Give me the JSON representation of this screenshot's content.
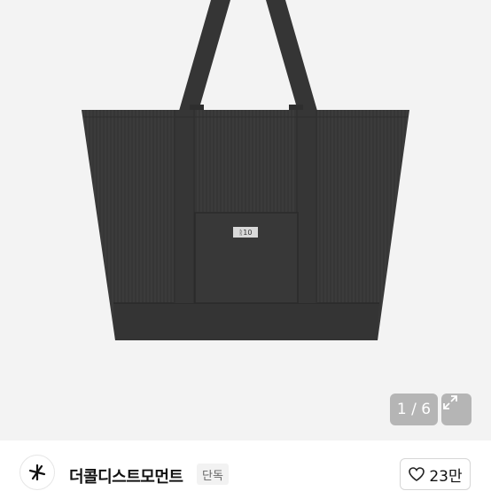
{
  "gallery": {
    "counter": "1 / 6",
    "product_tag": "ᚱ10",
    "expand_icon": "expand-icon"
  },
  "brand": {
    "name": "더콜디스트모먼트",
    "badge": "단독",
    "logo_icon": "star-logo-icon"
  },
  "like": {
    "count": "23만",
    "icon": "heart-icon"
  },
  "colors": {
    "bag": "#3a3a3a",
    "background": "#f3f3f3"
  }
}
